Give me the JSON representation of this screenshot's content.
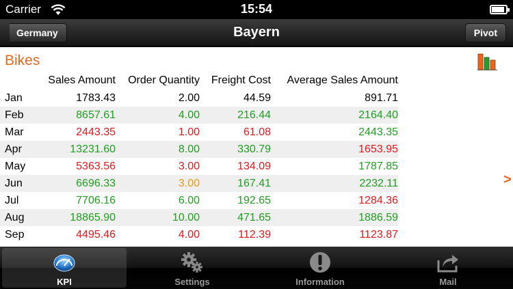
{
  "status": {
    "carrier": "Carrier",
    "time": "15:54"
  },
  "nav": {
    "back_label": "Germany",
    "title": "Bayern",
    "pivot_label": "Pivot"
  },
  "section": {
    "title": "Bikes"
  },
  "table": {
    "headers": [
      "",
      "Sales Amount",
      "Order Quantity",
      "Freight Cost",
      "Average Sales Amount"
    ],
    "rows": [
      {
        "month": "Jan",
        "sales": "1783.43",
        "qty": "2.00",
        "freight": "44.59",
        "avg": "891.71"
      },
      {
        "month": "Feb",
        "sales": "8657.61",
        "qty": "4.00",
        "freight": "216.44",
        "avg": "2164.40"
      },
      {
        "month": "Mar",
        "sales": "2443.35",
        "qty": "1.00",
        "freight": "61.08",
        "avg": "2443.35"
      },
      {
        "month": "Apr",
        "sales": "13231.60",
        "qty": "8.00",
        "freight": "330.79",
        "avg": "1653.95"
      },
      {
        "month": "May",
        "sales": "5363.56",
        "qty": "3.00",
        "freight": "134.09",
        "avg": "1787.85"
      },
      {
        "month": "Jun",
        "sales": "6696.33",
        "qty": "3.00",
        "freight": "167.41",
        "avg": "2232.11"
      },
      {
        "month": "Jul",
        "sales": "7706.16",
        "qty": "6.00",
        "freight": "192.65",
        "avg": "1284.36"
      },
      {
        "month": "Aug",
        "sales": "18865.90",
        "qty": "10.00",
        "freight": "471.65",
        "avg": "1886.59"
      },
      {
        "month": "Sep",
        "sales": "4495.46",
        "qty": "4.00",
        "freight": "112.39",
        "avg": "1123.87"
      }
    ]
  },
  "colors": {
    "positive": "#1e9e1e",
    "negative": "#e0181c",
    "neutral_change": "#eb9a12",
    "accent": "#e8661e"
  },
  "tabs": [
    {
      "label": "KPI",
      "icon": "kpi-gauge-icon",
      "active": true
    },
    {
      "label": "Settings",
      "icon": "gears-icon",
      "active": false
    },
    {
      "label": "Information",
      "icon": "exclamation-icon",
      "active": false
    },
    {
      "label": "Mail",
      "icon": "share-arrow-icon",
      "active": false
    }
  ]
}
